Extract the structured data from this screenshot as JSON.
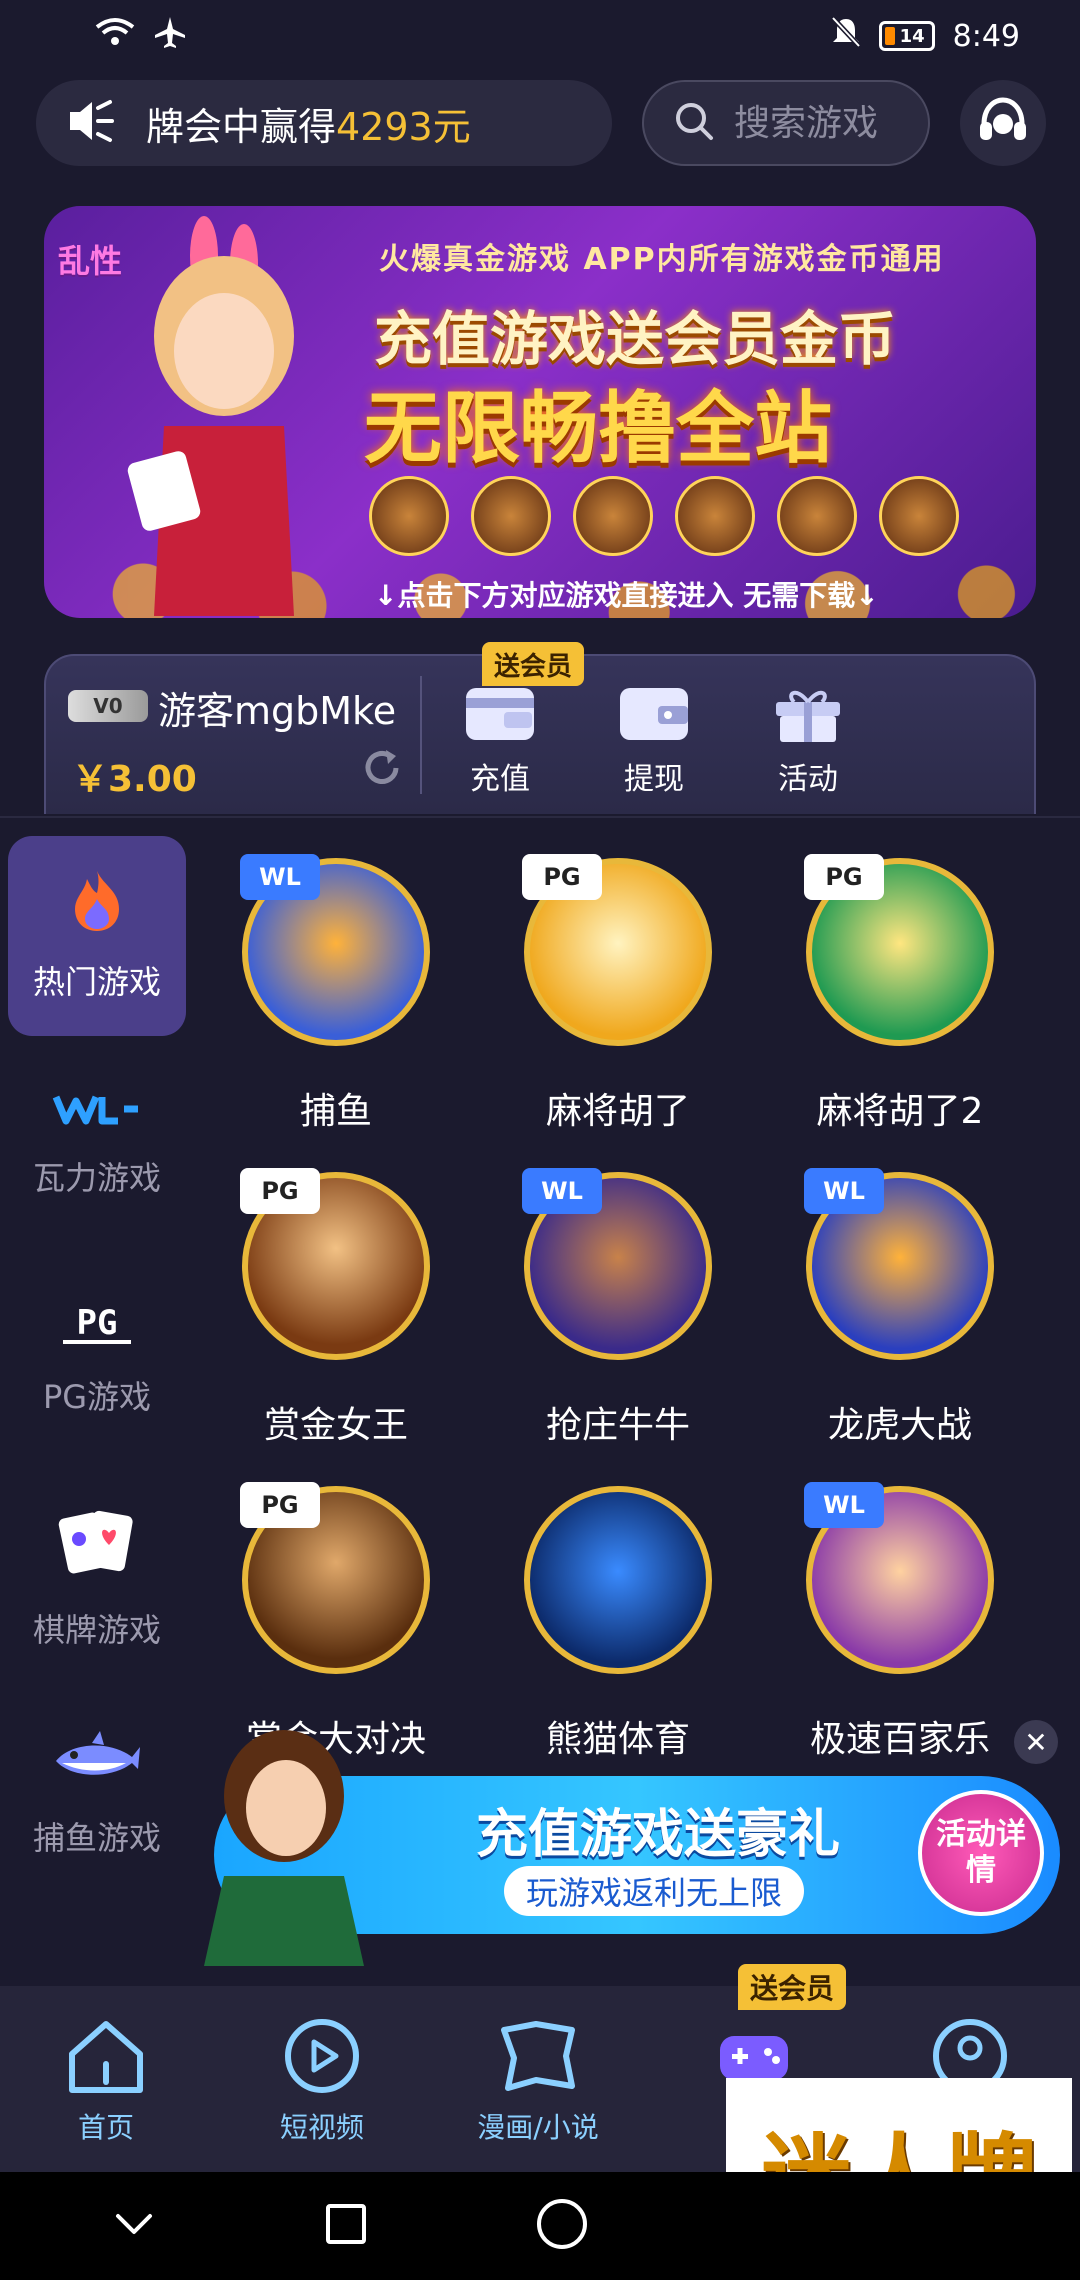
{
  "status_bar": {
    "time": "8:49",
    "battery": "14"
  },
  "marquee": {
    "text_prefix": "牌会中赢得",
    "amount": "4293元"
  },
  "search": {
    "placeholder": "搜索游戏"
  },
  "banner": {
    "logo": "乱性",
    "line1": "火爆真金游戏  APP内所有游戏金币通用",
    "line2": "充值游戏送会员金币",
    "line3": "无限畅撸全站",
    "footer": "↓点击下方对应游戏直接进入  无需下载↓"
  },
  "wallet": {
    "vip": "V0",
    "username": "游客mgbMke",
    "balance": "￥3.00",
    "gift_tag": "送会员",
    "actions": [
      {
        "label": "充值"
      },
      {
        "label": "提现"
      },
      {
        "label": "活动"
      }
    ]
  },
  "side_nav": [
    {
      "label": "热门游戏",
      "icon": "flame-icon"
    },
    {
      "label": "瓦力游戏",
      "icon": "wl-logo-icon"
    },
    {
      "label": "PG游戏",
      "icon": "pg-logo-icon"
    },
    {
      "label": "棋牌游戏",
      "icon": "cards-icon"
    },
    {
      "label": "捕鱼游戏",
      "icon": "shark-icon"
    }
  ],
  "games": [
    {
      "name": "捕鱼",
      "brand": "WL"
    },
    {
      "name": "麻将胡了",
      "brand": "PG"
    },
    {
      "name": "麻将胡了2",
      "brand": "PG"
    },
    {
      "name": "赏金女王",
      "brand": "PG"
    },
    {
      "name": "抢庄牛牛",
      "brand": "WL"
    },
    {
      "name": "龙虎大战",
      "brand": "WL"
    },
    {
      "name": "赏金大对决",
      "brand": "PG"
    },
    {
      "name": "熊猫体育",
      "brand": ""
    },
    {
      "name": "极速百家乐",
      "brand": "WL"
    }
  ],
  "promo": {
    "title": "充值游戏送豪礼",
    "subtitle": "玩游戏返利无上限",
    "button": "活动详情"
  },
  "bottom_nav": {
    "gift_tag": "送会员",
    "tabs": [
      {
        "label": "首页"
      },
      {
        "label": "短视频"
      },
      {
        "label": "漫画/小说"
      },
      {
        "label": ""
      },
      {
        "label": ""
      }
    ]
  },
  "watermark": "迷人牌",
  "colors": {
    "background": "#1b1a2e",
    "accent_gold": "#f5c036",
    "active_nav": "#4b3f8a"
  }
}
